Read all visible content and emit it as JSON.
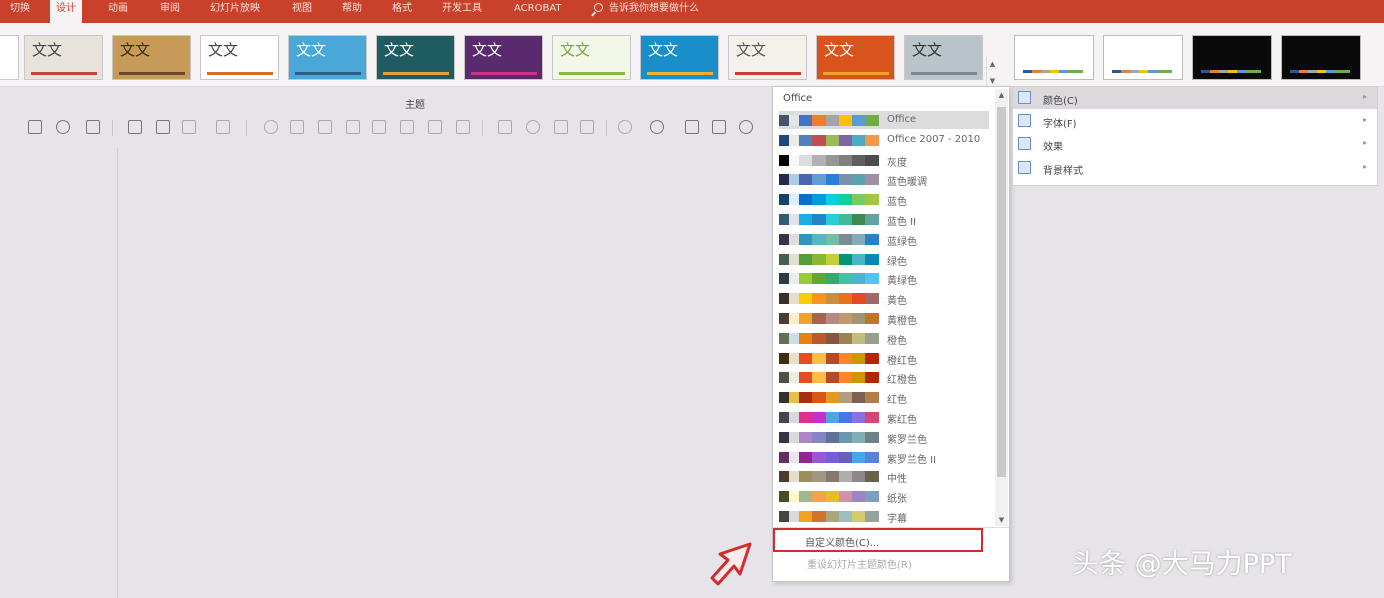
{
  "tabs": [
    "切换",
    "设计",
    "动画",
    "审阅",
    "幻灯片放映",
    "视图",
    "帮助",
    "格式",
    "开发工具",
    "ACROBAT"
  ],
  "active_tab": "设计",
  "tell_me": "告诉我你想要做什么",
  "themes": [
    {
      "text": "文文",
      "bg": "#e8e2dc",
      "fg": "#444444",
      "bar": "#b84a3a"
    },
    {
      "text": "文文",
      "bg": "#c89a58",
      "fg": "#3a2a1a",
      "bar": "#6a4a2a"
    },
    {
      "text": "文文",
      "bg": "#ffffff",
      "fg": "#444444",
      "bar": "#d07030"
    },
    {
      "text": "文文",
      "bg": "#4aa8d8",
      "fg": "#ffffff",
      "bar": "#2c5e8a"
    },
    {
      "text": "文文",
      "bg": "#1f5c62",
      "fg": "#ffffff",
      "bar": "#e8a030"
    },
    {
      "text": "文文",
      "bg": "#5a2a6e",
      "fg": "#ffffff",
      "bar": "#d03080"
    },
    {
      "text": "文文",
      "bg": "#f2f7e8",
      "fg": "#7aa83a",
      "bar": "#88b848"
    },
    {
      "text": "文文",
      "bg": "#1a8ec8",
      "fg": "#ffffff",
      "bar": "#f0b030"
    },
    {
      "text": "文文",
      "bg": "#f4f0ea",
      "fg": "#555555",
      "bar": "#c84030"
    },
    {
      "text": "文文",
      "bg": "#d8541c",
      "fg": "#ffffff",
      "bar": "#f2a030"
    },
    {
      "text": "文文",
      "bg": "#b8c4c8",
      "fg": "#333333",
      "bar": "#7a8a90"
    }
  ],
  "variants": [
    {
      "bg": "#ffffff"
    },
    {
      "bg": "#ffffff"
    },
    {
      "bg": "#0a0a0a"
    },
    {
      "bg": "#0a0a0a"
    }
  ],
  "group_label": "主题",
  "color_dropdown": {
    "header": "Office",
    "schemes": [
      {
        "name": "Office",
        "colors": [
          "#44546a",
          "#e7e6e6",
          "#4472c4",
          "#ed7d31",
          "#a5a5a5",
          "#ffc000",
          "#5b9bd5",
          "#70ad47"
        ]
      },
      {
        "name": "Office 2007 - 2010",
        "colors": [
          "#1f497d",
          "#eeece1",
          "#4f81bd",
          "#c0504d",
          "#9bbb59",
          "#8064a2",
          "#4bacc6",
          "#f79646"
        ]
      },
      {
        "name": "灰度",
        "colors": [
          "#000000",
          "#f8f8f8",
          "#dddddd",
          "#b2b2b2",
          "#969696",
          "#808080",
          "#5f5f5f",
          "#4d4d4d"
        ]
      },
      {
        "name": "蓝色暖调",
        "colors": [
          "#242852",
          "#acccea",
          "#4a66ac",
          "#629dd1",
          "#297fd5",
          "#7f8fa9",
          "#5aa2ae",
          "#9d90a0"
        ]
      },
      {
        "name": "蓝色",
        "colors": [
          "#17406d",
          "#dbeff9",
          "#0f6fc6",
          "#009dd9",
          "#0bd0d9",
          "#10cf9b",
          "#7cca62",
          "#a5c249"
        ]
      },
      {
        "name": "蓝色 II",
        "colors": [
          "#335b74",
          "#dfe3e5",
          "#1cade4",
          "#2683c6",
          "#27ced7",
          "#42ba97",
          "#3e8853",
          "#62a39f"
        ]
      },
      {
        "name": "蓝绿色",
        "colors": [
          "#373545",
          "#dedede",
          "#3494ba",
          "#58b6c0",
          "#75bda7",
          "#7a8c8e",
          "#84acb6",
          "#2683c6"
        ]
      },
      {
        "name": "绿色",
        "colors": [
          "#455f51",
          "#e3ded1",
          "#549e39",
          "#8ab833",
          "#c0cf3a",
          "#029676",
          "#4ab5c4",
          "#0989b1"
        ]
      },
      {
        "name": "黄绿色",
        "colors": [
          "#2c3c43",
          "#ebebeb",
          "#99cb38",
          "#63a537",
          "#37a76f",
          "#44c1a3",
          "#4eb3cf",
          "#51c3f9"
        ]
      },
      {
        "name": "黄色",
        "colors": [
          "#39302a",
          "#e5dec9",
          "#ffca08",
          "#f8931d",
          "#ce8d3e",
          "#ec7016",
          "#e64823",
          "#9c6a6a"
        ]
      },
      {
        "name": "黄橙色",
        "colors": [
          "#4e3b30",
          "#fbeec9",
          "#f0a22e",
          "#a5644e",
          "#b58b80",
          "#c3986d",
          "#a19574",
          "#c17529"
        ]
      },
      {
        "name": "橙色",
        "colors": [
          "#637052",
          "#ccddea",
          "#e48312",
          "#bd582c",
          "#865640",
          "#9b8357",
          "#c2bc80",
          "#94a088"
        ]
      },
      {
        "name": "橙红色",
        "colors": [
          "#3e2c13",
          "#eadfc8",
          "#e84c22",
          "#ffbd47",
          "#b64926",
          "#ff8427",
          "#cc9900",
          "#b22600"
        ]
      },
      {
        "name": "红橙色",
        "colors": [
          "#505046",
          "#eeece1",
          "#e84c22",
          "#ffbd47",
          "#b64926",
          "#ff8427",
          "#cc9900",
          "#b22600"
        ]
      },
      {
        "name": "红色",
        "colors": [
          "#323232",
          "#e5c243",
          "#a5300f",
          "#d55816",
          "#e19825",
          "#b19c7d",
          "#7f5f52",
          "#b27d49"
        ]
      },
      {
        "name": "紫红色",
        "colors": [
          "#454551",
          "#d8d9dc",
          "#e32d91",
          "#c830cc",
          "#4ea6dc",
          "#4775e7",
          "#8971e1",
          "#d54773"
        ]
      },
      {
        "name": "紫罗兰色",
        "colors": [
          "#373545",
          "#dcd8dc",
          "#ad84c6",
          "#8784c7",
          "#5d739a",
          "#6997af",
          "#84acb6",
          "#6f8183"
        ]
      },
      {
        "name": "紫罗兰色 II",
        "colors": [
          "#632e62",
          "#eae5eb",
          "#92278f",
          "#9b57d3",
          "#755dd9",
          "#665eb8",
          "#45a5ed",
          "#5982db"
        ]
      },
      {
        "name": "中性",
        "colors": [
          "#4e3b30",
          "#e7dec9",
          "#9e8e5c",
          "#a09781",
          "#85776d",
          "#aeafa9",
          "#8d878b",
          "#6b6149"
        ]
      },
      {
        "name": "纸张",
        "colors": [
          "#444d26",
          "#fefac9",
          "#a5b592",
          "#f3a447",
          "#e7bc29",
          "#d092a7",
          "#9c85c0",
          "#809ec2"
        ]
      },
      {
        "name": "字幕",
        "colors": [
          "#454545",
          "#dadada",
          "#f4a21d",
          "#d1722f",
          "#a9a57c",
          "#9cbebd",
          "#d2cb6c",
          "#95a39d"
        ]
      }
    ],
    "custom_label": "自定义颜色(C)...",
    "reset_label": "重设幻灯片主题颜色(R)"
  },
  "side_menu": [
    {
      "label": "颜色(C)",
      "icon": "color-palette-icon",
      "selected": true
    },
    {
      "label": "字体(F)",
      "icon": "font-icon",
      "selected": false
    },
    {
      "label": "效果",
      "icon": "effects-icon",
      "selected": false
    },
    {
      "label": "背景样式",
      "icon": "background-style-icon",
      "selected": false
    }
  ],
  "watermark": "头条 @大马力PPT"
}
